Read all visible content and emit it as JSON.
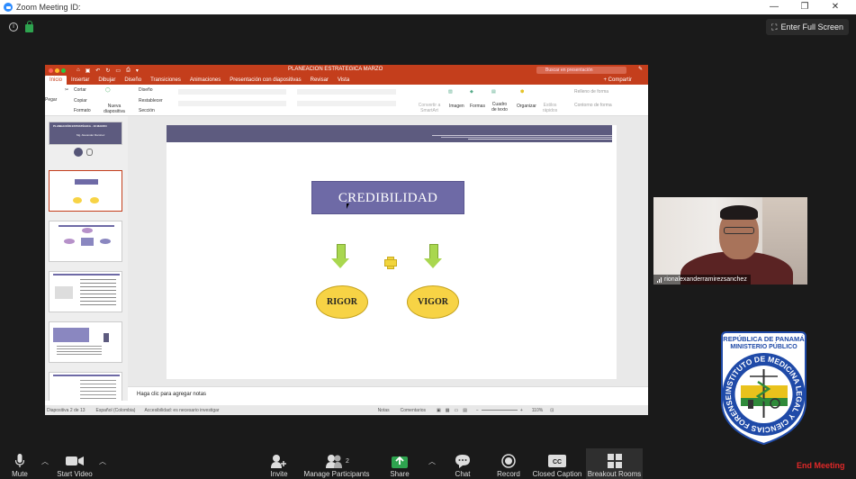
{
  "window": {
    "title": "Zoom Meeting ID:"
  },
  "topbar": {
    "fullscreen_label": "Enter Full Screen"
  },
  "ppt": {
    "doc_title": "PLANEACION ESTRATEGICA MARZO",
    "search_placeholder": "Buscar en presentación",
    "tabs": [
      "Inicio",
      "Insertar",
      "Dibujar",
      "Diseño",
      "Transiciones",
      "Animaciones",
      "Presentación con diapositivas",
      "Revisar",
      "Vista"
    ],
    "share_label": "Compartir",
    "ribbon": {
      "paste": "Pegar",
      "cut": "Cortar",
      "copy": "Copiar",
      "format": "Formato",
      "new_slide": "Nueva diapositiva",
      "design": "Diseño",
      "reset": "Restablecer",
      "section": "Sección",
      "convert": "Convertir a SmartArt",
      "image": "Imagen",
      "shapes": "Formas",
      "textbox": "Cuadro de texto",
      "arrange": "Organizar",
      "quick_styles": "Estilos rápidos",
      "shape_fill": "Relleno de forma",
      "shape_outline": "Contorno de forma"
    },
    "thumb1_title": "PLANEACIÓN ESTRATÉGICA - 10 MARZO",
    "thumb1_sub": "Mg. Alexander Ramírez",
    "slide": {
      "main_box": "CREDIBILIDAD",
      "left_oval": "RIGOR",
      "right_oval": "VIGOR"
    },
    "notes_placeholder": "Haga clic para agregar notas",
    "status": {
      "slide_count": "Diapositiva 2 de 13",
      "language": "Español (Colombia)",
      "accessibility": "Accesibilidad: es necesario investigar",
      "notes": "Notas",
      "comments": "Comentarios",
      "zoom": "110%"
    }
  },
  "video": {
    "participant_name": "rionalexanderramirezsanchez"
  },
  "seal": {
    "line1": "REPÚBLICA DE PANAMÁ",
    "line2": "MINISTERIO PÚBLICO",
    "ring_text": "INSTITUTO DE MEDICINA LEGAL Y CIENCIAS FORENSES"
  },
  "toolbar": {
    "mute": "Mute",
    "start_video": "Start Video",
    "invite": "Invite",
    "participants": "Manage Participants",
    "participants_count": "2",
    "share": "Share",
    "chat": "Chat",
    "record": "Record",
    "cc": "Closed Caption",
    "breakout": "Breakout Rooms",
    "end": "End Meeting"
  },
  "colors": {
    "ppt_accent": "#c43e1c",
    "zoom_share_green": "#2ea44f",
    "end_red": "#e02828",
    "slide_header": "#5d5b7f",
    "title_box": "#6e6aa6",
    "arrow_green": "#a9d74f",
    "oval_yellow": "#f7d345"
  }
}
